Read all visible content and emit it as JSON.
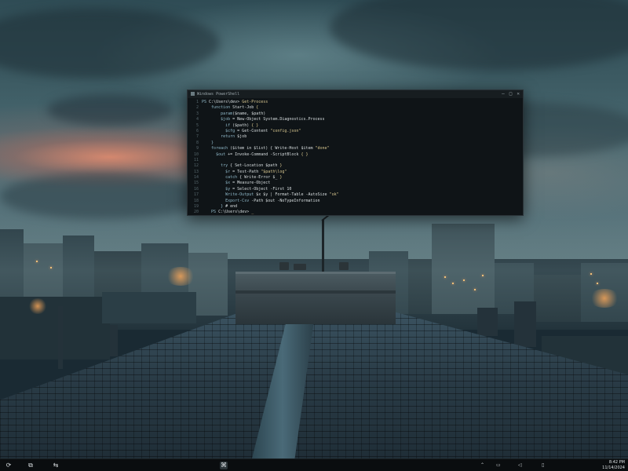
{
  "desktop": {
    "wallpaper": "dusk-rooftop-city",
    "colors": {
      "sky_top": "#2f4c55",
      "sunset": "#e68c6e",
      "roof": "#2a3c47",
      "terminal_bg": "#0f1417",
      "taskbar_bg": "#0a0d0f"
    }
  },
  "terminal": {
    "title": "Windows PowerShell",
    "controls": {
      "minimize": "–",
      "maximize": "□",
      "close": "✕"
    },
    "line_numbers": [
      "1",
      "2",
      "3",
      "4",
      "5",
      "6",
      "7",
      "8",
      "9",
      "10",
      "11",
      "12",
      "13",
      "14",
      "15",
      "16",
      "17",
      "18",
      "19",
      "20"
    ],
    "lines": [
      {
        "indent": "",
        "k": "PS",
        "t": " C:\\Users\\dev> ",
        "s": "Get-Process"
      },
      {
        "indent": "    ",
        "k": "function",
        "t": " Start-Job ",
        "s": "{"
      },
      {
        "indent": "        ",
        "k": "param",
        "t": "($name, $path) ",
        "s": ""
      },
      {
        "indent": "        ",
        "k": "$job",
        "t": " = New-Object System.Diagnostics.Process ",
        "s": ""
      },
      {
        "indent": "          ",
        "k": "if",
        "t": " ($path) ",
        "s": "{ }"
      },
      {
        "indent": "          ",
        "k": "$cfg",
        "t": " = Get-Content ",
        "s": "\"config.json\""
      },
      {
        "indent": "        ",
        "k": "return",
        "t": " $job ",
        "s": ""
      },
      {
        "indent": "    ",
        "k": "}",
        "t": "",
        "s": ""
      },
      {
        "indent": "    ",
        "k": "foreach",
        "t": " ($item in $list) { Write-Host $item ",
        "s": "\"done\""
      },
      {
        "indent": "      ",
        "k": "$out",
        "t": " += Invoke-Command -ScriptBlock ",
        "s": "{ }"
      },
      {
        "indent": "",
        "k": "",
        "t": "",
        "s": ""
      },
      {
        "indent": "        ",
        "k": "try",
        "t": " { Set-Location $path ",
        "s": "}"
      },
      {
        "indent": "          ",
        "k": "$r",
        "t": " = Test-Path ",
        "s": "\"$path\\log\""
      },
      {
        "indent": "          ",
        "k": "catch",
        "t": " { Write-Error $_ ",
        "s": "}"
      },
      {
        "indent": "          ",
        "k": "$x",
        "t": " = Measure-Object ",
        "s": ""
      },
      {
        "indent": "          ",
        "k": "$y",
        "t": " = Select-Object -First 10 ",
        "s": ""
      },
      {
        "indent": "          ",
        "k": "Write-Output",
        "t": " $x $y | Format-Table -AutoSize ",
        "s": "\"ok\""
      },
      {
        "indent": "          ",
        "k": "Export-Csv",
        "t": " -Path $out -NoTypeInformation ",
        "s": ""
      },
      {
        "indent": "        ",
        "k": "}",
        "t": " # end",
        "s": ""
      },
      {
        "indent": "    ",
        "k": "PS",
        "t": " C:\\Users\\dev> ",
        "s": "_"
      }
    ]
  },
  "taskbar": {
    "left_icons": [
      {
        "name": "start-icon",
        "glyph": "⟳"
      },
      {
        "name": "task-view-icon",
        "glyph": "⧉"
      },
      {
        "name": "widgets-icon",
        "glyph": "⇆"
      }
    ],
    "center_icons": [
      {
        "name": "terminal-app-icon",
        "glyph": "⌘"
      }
    ],
    "tray": [
      {
        "name": "chevron-up-icon",
        "glyph": "⌃"
      },
      {
        "name": "network-icon",
        "glyph": "▭"
      },
      {
        "name": "volume-icon",
        "glyph": "◁"
      },
      {
        "name": "battery-icon",
        "glyph": "▯"
      }
    ],
    "clock_time": "8:42 PM",
    "clock_date": "11/14/2024"
  }
}
